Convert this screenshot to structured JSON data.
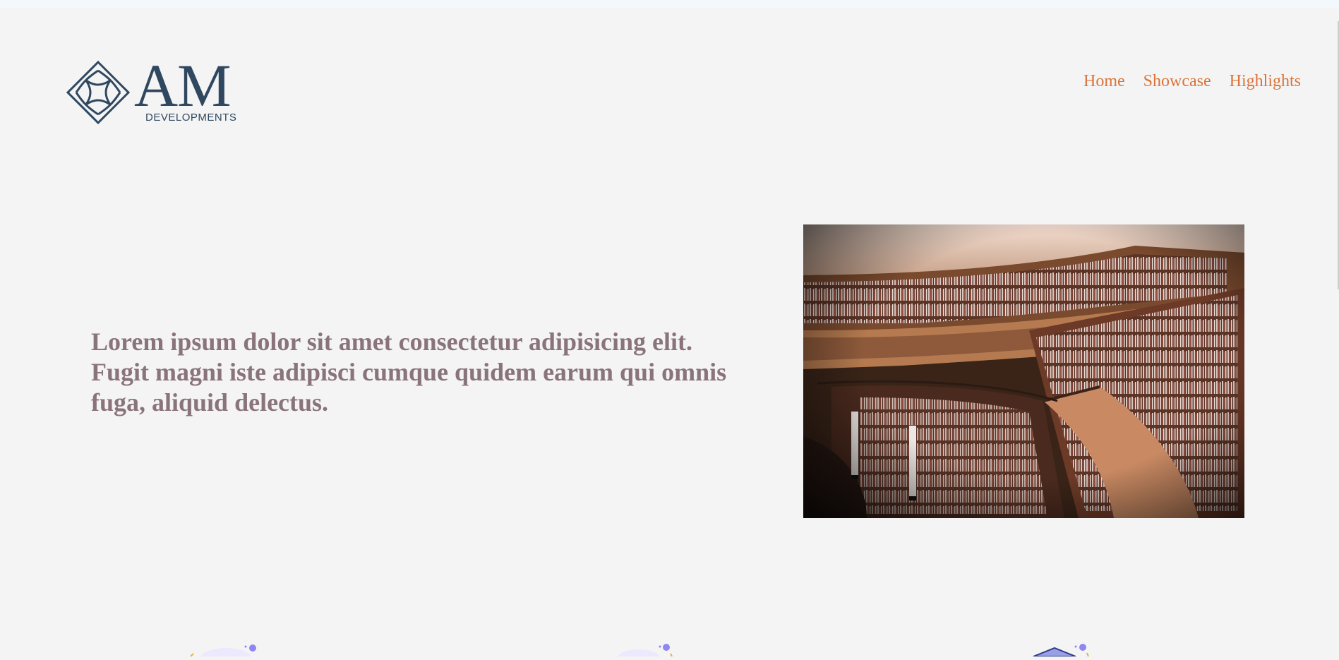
{
  "logo": {
    "word": "AM",
    "sub": "DEVELOPMENTS"
  },
  "nav": {
    "items": [
      "Home",
      "Showcase",
      "Highlights"
    ]
  },
  "hero": {
    "text": "Lorem ipsum dolor sit amet consectetur adipisicing elit. Fugit magni iste adipisci cumque quidem earum qui omnis fuga, aliquid delectus."
  },
  "colors": {
    "background": "#f4f4f4",
    "nav_link": "#d9743a",
    "logo": "#2f4860",
    "hero_text": "#8a747c",
    "accent_dot": "#8f86f2"
  }
}
